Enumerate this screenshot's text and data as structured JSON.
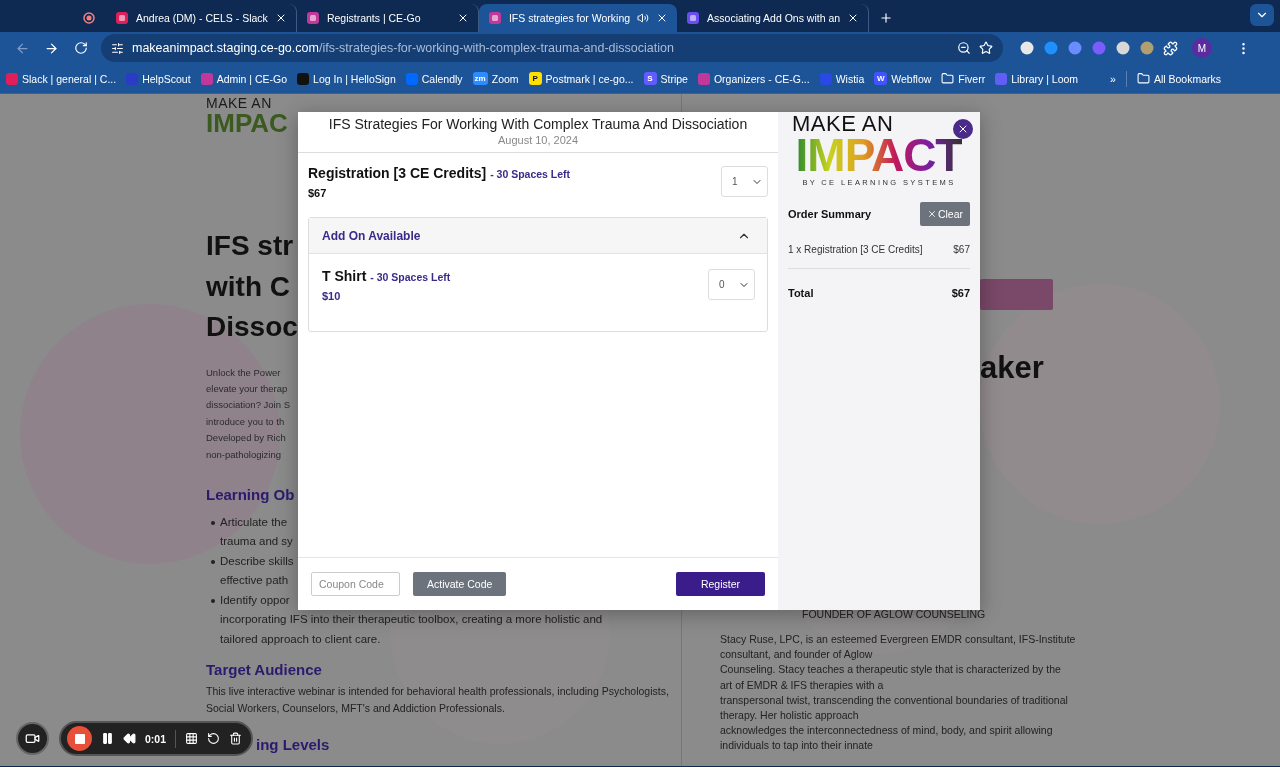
{
  "browser": {
    "tabs": [
      {
        "title": "Andrea (DM) - CELS - Slack",
        "selected": false,
        "playing_audio": false,
        "color": "#e01e5a"
      },
      {
        "title": "Registrants | CE-Go",
        "selected": false,
        "playing_audio": false,
        "color": "#c2389a"
      },
      {
        "title": "IFS strategies for Working",
        "selected": true,
        "playing_audio": true,
        "color": "#c2389a"
      },
      {
        "title": "Associating Add Ons with an",
        "selected": false,
        "playing_audio": false,
        "color": "#6a4cf0"
      }
    ],
    "url": {
      "host": "makeanimpact.staging.ce-go.com",
      "path": "/ifs-strategies-for-working-with-complex-trauma-and-dissociation"
    },
    "profile_initial": "M",
    "bookmarks": [
      {
        "label": "Slack | general | C...",
        "kind": "dot",
        "color": "#e01e5a"
      },
      {
        "label": "HelpScout",
        "kind": "dot",
        "color": "#2a3cc7"
      },
      {
        "label": "Admin | CE-Go",
        "kind": "dot",
        "color": "#c2389a"
      },
      {
        "label": "Log In | HelloSign",
        "kind": "dot",
        "color": "#111111"
      },
      {
        "label": "Calendly",
        "kind": "dot",
        "color": "#0069ff"
      },
      {
        "label": "Zoom",
        "kind": "badge",
        "badge": "zm",
        "color": "#2d8cff"
      },
      {
        "label": "Postmark | ce-go...",
        "kind": "badge",
        "badge": "P",
        "color": "#ffde00"
      },
      {
        "label": "Stripe",
        "kind": "badge",
        "badge": "S",
        "color": "#635bff"
      },
      {
        "label": "Organizers - CE-G...",
        "kind": "dot",
        "color": "#c2389a"
      },
      {
        "label": "Wistia",
        "kind": "dot",
        "color": "#2949e5"
      },
      {
        "label": "Webflow",
        "kind": "badge",
        "badge": "W",
        "color": "#4353ff"
      },
      {
        "label": "Fiverr",
        "kind": "folder"
      },
      {
        "label": "Library | Loom",
        "kind": "dot",
        "color": "#625df5"
      }
    ],
    "more": "»",
    "all_bookmarks": "All Bookmarks"
  },
  "page": {
    "logo": {
      "top": "MAKE AN",
      "main": "IMPAC"
    },
    "headline": [
      "IFS str",
      "with C",
      "Dissoc"
    ],
    "intro": [
      "Unlock the Power",
      "elevate your therap",
      "dissociation? Join S",
      "introduce you to th",
      "Developed by Rich",
      "non-pathologizing"
    ],
    "objectives_heading": "Learning Ob",
    "objectives": [
      [
        "Articulate the",
        "trauma and sy"
      ],
      [
        "Describe skills",
        "effective path"
      ],
      [
        "Identify oppor",
        "incorporating IFS into their therapeutic toolbox, creating a more holistic and",
        "tailored approach to client care."
      ]
    ],
    "audience_heading": "Target Audience",
    "audience_text": "This live interactive webinar is intended for behavioral health professionals, including Psychologists, Social Workers, Counselors, MFT's and Addiction Professionals.",
    "levels_heading": "ing Levels",
    "speaker_heading": "aker",
    "speaker_title": "FOUNDER OF AGLOW COUNSELING",
    "speaker_bio": [
      "Stacy Ruse, LPC, is an esteemed Evergreen EMDR consultant, IFS-Institute",
      "consultant, and founder of Aglow",
      "Counseling. Stacy teaches a therapeutic style that is characterized by the",
      "art of EMDR & IFS therapies with a",
      "transpersonal twist, transcending the conventional boundaries of traditional",
      "therapy. Her holistic approach",
      "acknowledges the interconnectedness of mind, body, and spirit allowing",
      "individuals to tap into their innate"
    ]
  },
  "modal": {
    "title": "IFS Strategies For Working With Complex Trauma And Dissociation",
    "date": "August 10, 2024",
    "ticket": {
      "name": "Registration [3 CE Credits]",
      "availability": "- 30 Spaces Left",
      "price": "$67",
      "quantity": "1"
    },
    "addons": {
      "heading": "Add On Available",
      "expanded": true,
      "items": [
        {
          "name": "T Shirt",
          "availability": "- 30 Spaces Left",
          "price": "$10",
          "quantity": "0"
        }
      ]
    },
    "coupon_placeholder": "Coupon Code",
    "activate_label": "Activate Code",
    "register_label": "Register",
    "logo": {
      "top": "MAKE AN",
      "main": "IMPACT",
      "by": "BY",
      "sub": "CE LEARNING SYSTEMS"
    },
    "summary": {
      "heading": "Order Summary",
      "clear_label": "Clear",
      "lines": [
        {
          "label": "1 x Registration [3 CE Credits]",
          "amount": "$67"
        }
      ],
      "total_label": "Total",
      "total": "$67"
    }
  },
  "recorder": {
    "time": "0:01"
  }
}
